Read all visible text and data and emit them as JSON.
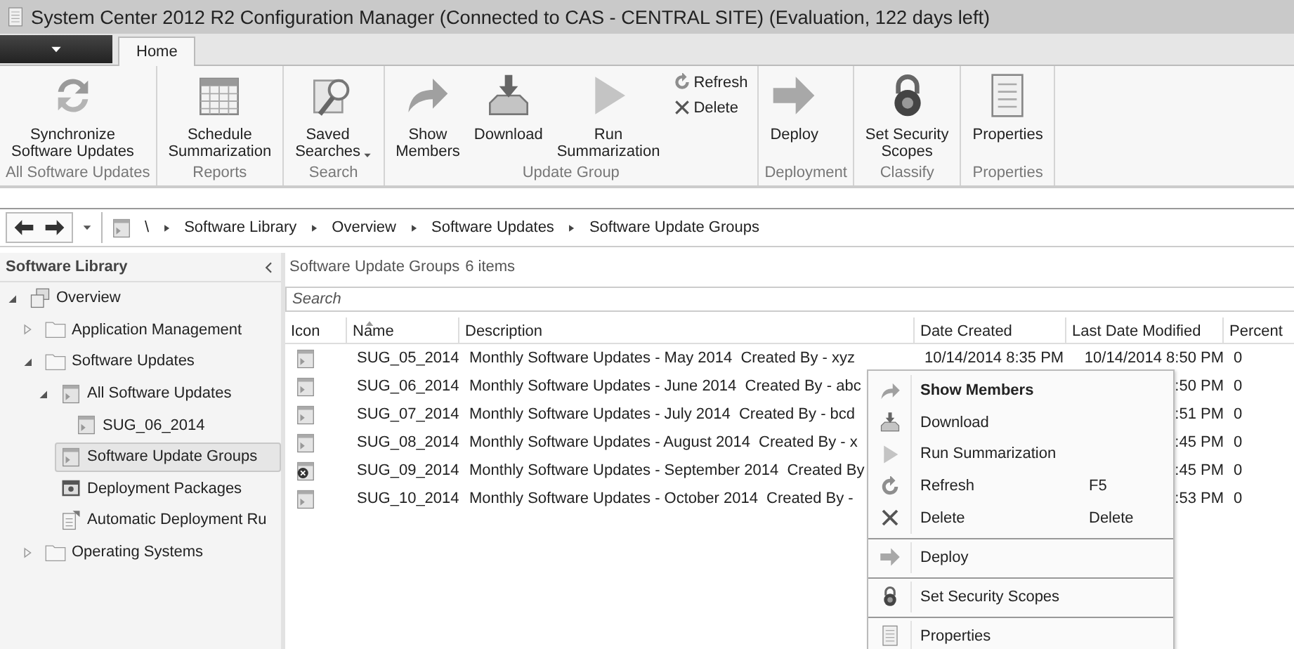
{
  "window": {
    "title": "System Center 2012 R2 Configuration Manager (Connected to CAS - CENTRAL SITE) (Evaluation, 122 days left)"
  },
  "ribbon": {
    "tabs": [
      {
        "label": "Home",
        "selected": true
      }
    ],
    "groups": [
      {
        "label": "All Software Updates",
        "buttons": [
          {
            "kind": "large",
            "lines": [
              "Synchronize",
              "Software Updates"
            ]
          }
        ]
      },
      {
        "label": "Reports",
        "buttons": [
          {
            "kind": "large",
            "lines": [
              "Schedule",
              "Summarization"
            ]
          }
        ]
      },
      {
        "label": "Search",
        "buttons": [
          {
            "kind": "large",
            "lines": [
              "Saved",
              "Searches"
            ],
            "dropdown": true
          }
        ]
      },
      {
        "label": "Update Group",
        "buttons": [
          {
            "kind": "large",
            "lines": [
              "Show",
              "Members"
            ]
          },
          {
            "kind": "large",
            "lines": [
              "Download"
            ]
          },
          {
            "kind": "large",
            "lines": [
              "Run",
              "Summarization"
            ]
          },
          {
            "kind": "small",
            "lines": [
              "Refresh"
            ]
          },
          {
            "kind": "small",
            "lines": [
              "Delete"
            ]
          }
        ]
      },
      {
        "label": "Deployment",
        "buttons": [
          {
            "kind": "large",
            "lines": [
              "Deploy"
            ]
          }
        ]
      },
      {
        "label": "Classify",
        "buttons": [
          {
            "kind": "large",
            "lines": [
              "Set Security",
              "Scopes"
            ]
          }
        ]
      },
      {
        "label": "Properties",
        "buttons": [
          {
            "kind": "large",
            "lines": [
              "Properties"
            ]
          }
        ]
      }
    ]
  },
  "nav": {
    "path": [
      "\\",
      "Software Library",
      "Overview",
      "Software Updates",
      "Software Update Groups"
    ]
  },
  "tree": {
    "header": "Software Library",
    "items": [
      {
        "label": "Overview",
        "expanded": true,
        "selected": false,
        "children": [
          {
            "label": "Application Management",
            "expanded": false,
            "selected": false
          },
          {
            "label": "Software Updates",
            "expanded": true,
            "selected": false,
            "children": [
              {
                "label": "All Software Updates",
                "expanded": true,
                "selected": false,
                "children": [
                  {
                    "label": "SUG_06_2014",
                    "selected": false
                  }
                ]
              },
              {
                "label": "Software Update Groups",
                "selected": true
              },
              {
                "label": "Deployment Packages",
                "selected": false
              },
              {
                "label": "Automatic Deployment Ru",
                "selected": false
              }
            ]
          },
          {
            "label": "Operating Systems",
            "expanded": false,
            "selected": false
          }
        ]
      }
    ]
  },
  "list": {
    "title": "Software Update Groups",
    "count": "6 items",
    "search": {
      "placeholder": "Search"
    },
    "columns": [
      {
        "label": "Icon",
        "sorted": false
      },
      {
        "label": "Name",
        "sorted": true
      },
      {
        "label": "Description",
        "sorted": false
      },
      {
        "label": "Date Created",
        "sorted": false
      },
      {
        "label": "Last Date Modified",
        "sorted": false
      },
      {
        "label": "Percent",
        "sorted": false
      }
    ],
    "rows": [
      {
        "error": false,
        "name": "SUG_05_2014",
        "description": "Monthly Software Updates - May 2014  Created By - xyz",
        "date_created": "10/14/2014 8:35 PM",
        "last_modified": "10/14/2014 8:50 PM",
        "percent": "0"
      },
      {
        "error": false,
        "name": "SUG_06_2014",
        "description": "Monthly Software Updates - June 2014  Created By - abc",
        "last_modified": ":50 PM",
        "percent": "0"
      },
      {
        "error": false,
        "name": "SUG_07_2014",
        "description": "Monthly Software Updates - July 2014  Created By - bcd",
        "last_modified": ":51 PM",
        "percent": "0"
      },
      {
        "error": false,
        "name": "SUG_08_2014",
        "description": "Monthly Software Updates - August 2014  Created By - x",
        "last_modified": ":45 PM",
        "percent": "0"
      },
      {
        "error": true,
        "name": "SUG_09_2014",
        "description": "Monthly Software Updates - September 2014  Created By",
        "last_modified": ":45 PM",
        "percent": "0"
      },
      {
        "error": false,
        "name": "SUG_10_2014",
        "description": "Monthly Software Updates - October 2014  Created By -",
        "last_modified": ":53 PM",
        "percent": "0"
      }
    ]
  },
  "context_menu": {
    "items": [
      {
        "label": "Show Members",
        "default": true,
        "separator_before": false
      },
      {
        "label": "Download",
        "default": false,
        "separator_before": false
      },
      {
        "label": "Run Summarization",
        "default": false,
        "separator_before": false
      },
      {
        "label": "Refresh",
        "shortcut": "F5",
        "default": false,
        "separator_before": false
      },
      {
        "label": "Delete",
        "shortcut": "Delete",
        "default": false,
        "separator_before": false
      },
      {
        "label": "Deploy",
        "default": false,
        "separator_before": true
      },
      {
        "label": "Set Security Scopes",
        "default": false,
        "separator_before": true
      },
      {
        "label": "Properties",
        "default": false,
        "separator_before": true
      }
    ]
  }
}
